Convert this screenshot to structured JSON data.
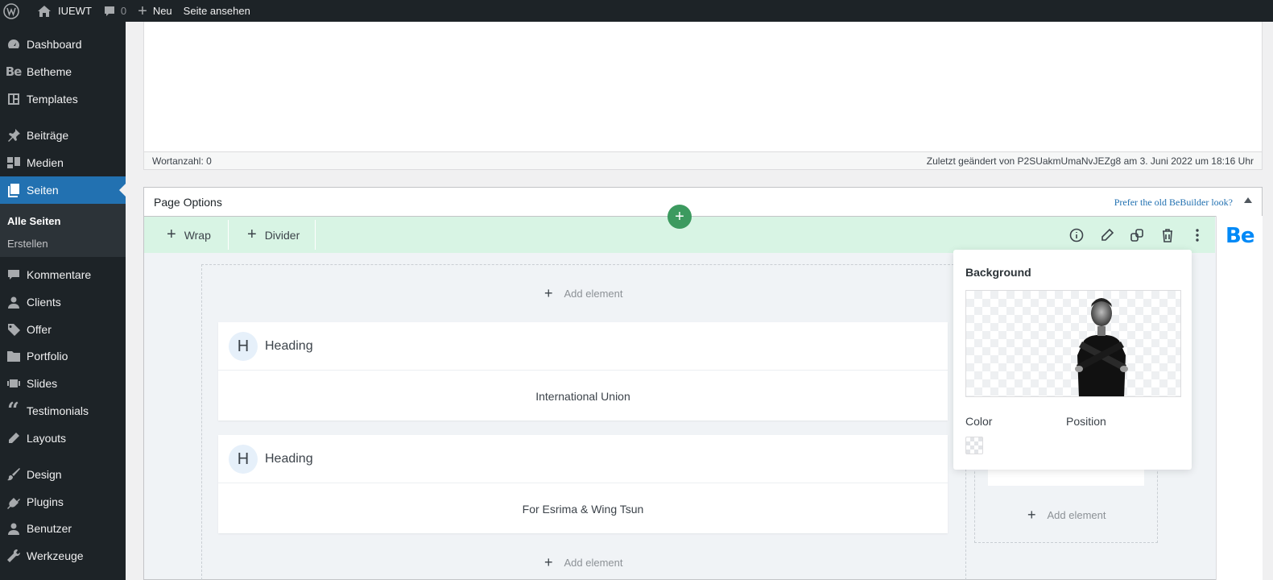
{
  "adminbar": {
    "site_name": "IUEWT",
    "comment_count": "0",
    "new_label": "Neu",
    "view_label": "Seite ansehen"
  },
  "sidebar": {
    "items": [
      {
        "label": "Dashboard",
        "icon": "dashboard-icon"
      },
      {
        "label": "Betheme",
        "icon": "betheme-icon"
      },
      {
        "label": "Templates",
        "icon": "templates-icon"
      },
      {
        "label": "Beiträge",
        "icon": "pin-icon"
      },
      {
        "label": "Medien",
        "icon": "media-icon"
      },
      {
        "label": "Seiten",
        "icon": "pages-icon",
        "active": true
      },
      {
        "label": "Kommentare",
        "icon": "comment-icon"
      },
      {
        "label": "Clients",
        "icon": "user-icon"
      },
      {
        "label": "Offer",
        "icon": "tag-icon"
      },
      {
        "label": "Portfolio",
        "icon": "folder-icon"
      },
      {
        "label": "Slides",
        "icon": "slides-icon"
      },
      {
        "label": "Testimonials",
        "icon": "quote-icon"
      },
      {
        "label": "Layouts",
        "icon": "pencil-icon"
      },
      {
        "label": "Design",
        "icon": "brush-icon"
      },
      {
        "label": "Plugins",
        "icon": "plugin-icon"
      },
      {
        "label": "Benutzer",
        "icon": "user-icon"
      },
      {
        "label": "Werkzeuge",
        "icon": "wrench-icon"
      }
    ],
    "submenu": {
      "all_pages": "Alle Seiten",
      "create": "Erstellen"
    }
  },
  "editor": {
    "word_count": "Wortanzahl: 0",
    "last_modified": "Zuletzt geändert von P2SUakmUmaNvJEZg8 am 3. Juni 2022 um 18:16 Uhr"
  },
  "page_options": {
    "title": "Page Options",
    "old_builder_link": "Prefer the old BeBuilder look?"
  },
  "builder": {
    "wrap_label": "Wrap",
    "divider_label": "Divider",
    "add_element_label": "Add element",
    "be_logo": "Be",
    "elements": [
      {
        "badge": "H",
        "name": "Heading",
        "content": "International Union"
      },
      {
        "badge": "H",
        "name": "Heading",
        "content": "For Esrima & Wing Tsun"
      }
    ]
  },
  "popup": {
    "title": "Background",
    "color_label": "Color",
    "position_label": "Position"
  },
  "colors": {
    "admin_bg": "#1d2327",
    "active_blue": "#2271b1",
    "builder_green": "#d8f4e4",
    "add_button_green": "#3c9a5f",
    "be_blue": "#0089f7"
  }
}
